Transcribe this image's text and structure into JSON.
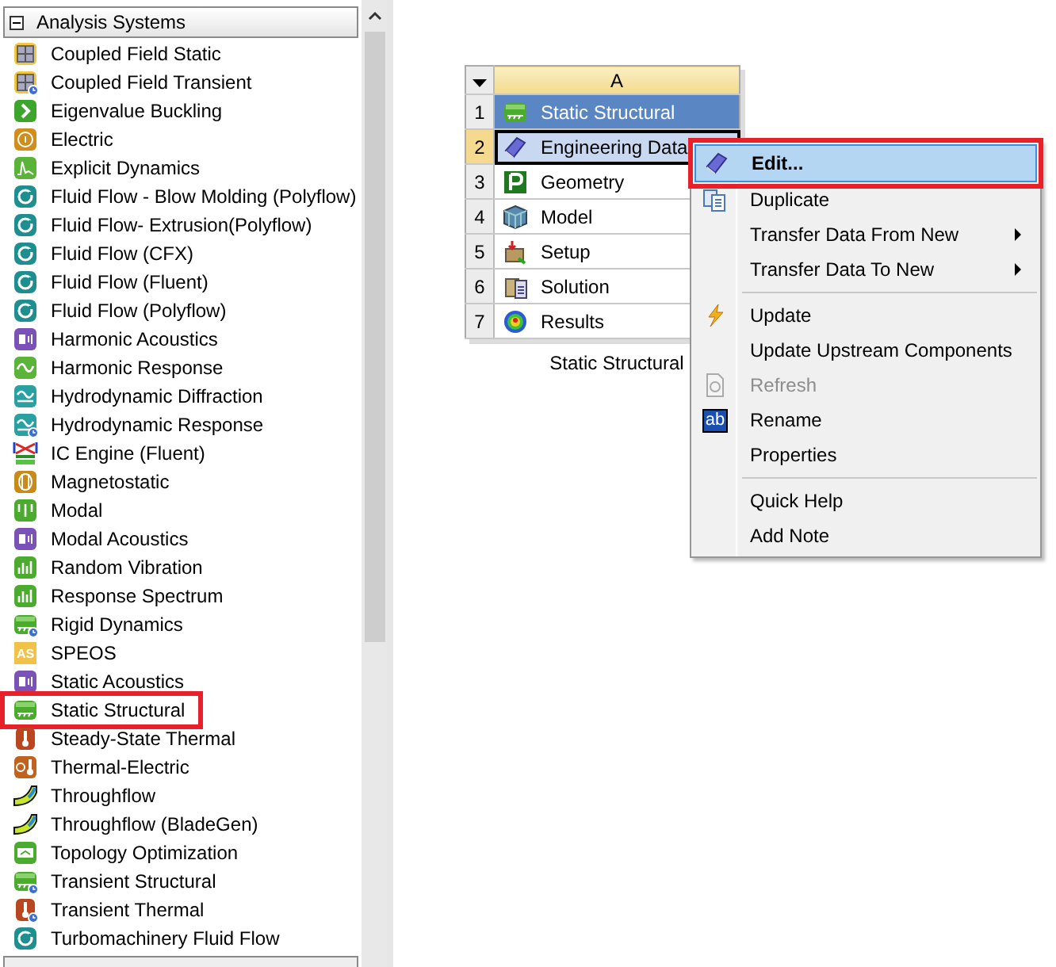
{
  "toolbox": {
    "group": {
      "label": "Analysis Systems",
      "expanded": true
    },
    "items": [
      {
        "label": "Coupled Field Static",
        "kind": "coupled",
        "transient": false,
        "annotated": false
      },
      {
        "label": "Coupled Field Transient",
        "kind": "coupled",
        "transient": true,
        "annotated": false
      },
      {
        "label": "Eigenvalue Buckling",
        "kind": "buckling",
        "transient": false,
        "annotated": false
      },
      {
        "label": "Electric",
        "kind": "electric",
        "transient": false,
        "annotated": false
      },
      {
        "label": "Explicit Dynamics",
        "kind": "explicit",
        "transient": false,
        "annotated": false
      },
      {
        "label": "Fluid Flow - Blow Molding (Polyflow)",
        "kind": "fluid",
        "transient": false,
        "annotated": false
      },
      {
        "label": "Fluid Flow- Extrusion(Polyflow)",
        "kind": "fluid",
        "transient": false,
        "annotated": false
      },
      {
        "label": "Fluid Flow (CFX)",
        "kind": "fluid",
        "transient": false,
        "annotated": false
      },
      {
        "label": "Fluid Flow (Fluent)",
        "kind": "fluid",
        "transient": false,
        "annotated": false
      },
      {
        "label": "Fluid Flow (Polyflow)",
        "kind": "fluid",
        "transient": false,
        "annotated": false
      },
      {
        "label": "Harmonic Acoustics",
        "kind": "acoustic",
        "transient": false,
        "annotated": false
      },
      {
        "label": "Harmonic Response",
        "kind": "harmonic",
        "transient": false,
        "annotated": false
      },
      {
        "label": "Hydrodynamic Diffraction",
        "kind": "hydro",
        "transient": false,
        "annotated": false
      },
      {
        "label": "Hydrodynamic Response",
        "kind": "hydro",
        "transient": true,
        "annotated": false
      },
      {
        "label": "IC Engine (Fluent)",
        "kind": "engine",
        "transient": false,
        "annotated": false
      },
      {
        "label": "Magnetostatic",
        "kind": "magneto",
        "transient": false,
        "annotated": false
      },
      {
        "label": "Modal",
        "kind": "modal",
        "transient": false,
        "annotated": false
      },
      {
        "label": "Modal Acoustics",
        "kind": "acoustic",
        "transient": false,
        "annotated": false
      },
      {
        "label": "Random Vibration",
        "kind": "spectrum",
        "transient": false,
        "annotated": false
      },
      {
        "label": "Response Spectrum",
        "kind": "spectrum",
        "transient": false,
        "annotated": false
      },
      {
        "label": "Rigid Dynamics",
        "kind": "structural",
        "transient": true,
        "annotated": false
      },
      {
        "label": "SPEOS",
        "kind": "speos",
        "icon_text": "AS",
        "transient": false,
        "annotated": false
      },
      {
        "label": "Static Acoustics",
        "kind": "acoustic",
        "transient": false,
        "annotated": false
      },
      {
        "label": "Static Structural",
        "kind": "structural",
        "transient": false,
        "annotated": true
      },
      {
        "label": "Steady-State Thermal",
        "kind": "thermal",
        "transient": false,
        "annotated": false
      },
      {
        "label": "Thermal-Electric",
        "kind": "thermoelectric",
        "transient": false,
        "annotated": false
      },
      {
        "label": "Throughflow",
        "kind": "blade",
        "transient": false,
        "annotated": false
      },
      {
        "label": "Throughflow (BladeGen)",
        "kind": "blade",
        "transient": false,
        "annotated": false
      },
      {
        "label": "Topology Optimization",
        "kind": "topology",
        "transient": false,
        "annotated": false
      },
      {
        "label": "Transient Structural",
        "kind": "structural",
        "transient": true,
        "annotated": false
      },
      {
        "label": "Transient Thermal",
        "kind": "thermal",
        "transient": true,
        "annotated": false
      },
      {
        "label": "Turbomachinery Fluid Flow",
        "kind": "fluid",
        "transient": false,
        "annotated": false
      }
    ]
  },
  "system": {
    "column": "A",
    "caption": "Static Structural",
    "rows": [
      {
        "number": "1",
        "label": "Static Structural",
        "kind": "title",
        "selected": false
      },
      {
        "number": "2",
        "label": "Engineering Data",
        "kind": "data",
        "selected": true
      },
      {
        "number": "3",
        "label": "Geometry",
        "kind": "geometry",
        "selected": false
      },
      {
        "number": "4",
        "label": "Model",
        "kind": "model",
        "selected": false
      },
      {
        "number": "5",
        "label": "Setup",
        "kind": "setup",
        "selected": false
      },
      {
        "number": "6",
        "label": "Solution",
        "kind": "solution",
        "selected": false
      },
      {
        "number": "7",
        "label": "Results",
        "kind": "results",
        "selected": false
      }
    ]
  },
  "context_menu": {
    "items": [
      {
        "label": "Edit...",
        "kind": "edit",
        "highlighted": true,
        "annotated": true,
        "disabled": false,
        "submenu": false,
        "separator_before": false
      },
      {
        "label": "Duplicate",
        "kind": "duplicate",
        "highlighted": false,
        "annotated": false,
        "disabled": false,
        "submenu": false,
        "separator_before": false
      },
      {
        "label": "Transfer Data From New",
        "highlighted": false,
        "annotated": false,
        "disabled": false,
        "submenu": true,
        "separator_before": false
      },
      {
        "label": "Transfer Data To New",
        "highlighted": false,
        "annotated": false,
        "disabled": false,
        "submenu": true,
        "separator_before": false
      },
      {
        "label": "Update",
        "kind": "update",
        "highlighted": false,
        "annotated": false,
        "disabled": false,
        "submenu": false,
        "separator_before": true
      },
      {
        "label": "Update Upstream Components",
        "highlighted": false,
        "annotated": false,
        "disabled": false,
        "submenu": false,
        "separator_before": false
      },
      {
        "label": "Refresh",
        "kind": "refresh",
        "highlighted": false,
        "annotated": false,
        "disabled": true,
        "submenu": false,
        "separator_before": false
      },
      {
        "label": "Rename",
        "kind": "rename",
        "icon_text": "ab",
        "highlighted": false,
        "annotated": false,
        "disabled": false,
        "submenu": false,
        "separator_before": false
      },
      {
        "label": "Properties",
        "highlighted": false,
        "annotated": false,
        "disabled": false,
        "submenu": false,
        "separator_before": false
      },
      {
        "label": "Quick Help",
        "highlighted": false,
        "annotated": false,
        "disabled": false,
        "submenu": false,
        "separator_before": true
      },
      {
        "label": "Add Note",
        "highlighted": false,
        "annotated": false,
        "disabled": false,
        "submenu": false,
        "separator_before": false
      }
    ]
  }
}
